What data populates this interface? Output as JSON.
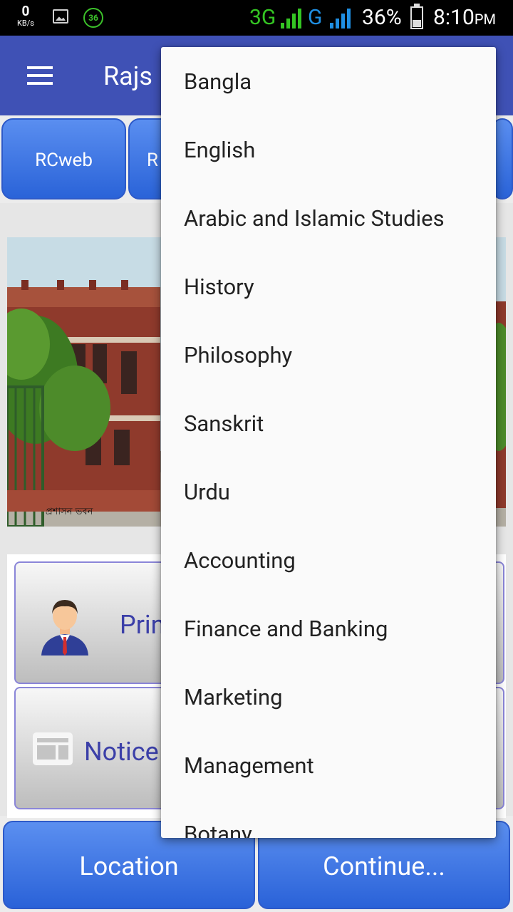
{
  "status_bar": {
    "speed_value": "0",
    "speed_unit": "KB/s",
    "badge": "36",
    "network_3g": "3G",
    "network_g": "G",
    "battery": "36%",
    "time": "8:10",
    "ampm": "PM"
  },
  "appbar": {
    "title": "Rajs"
  },
  "top_buttons": [
    "RCweb",
    "R"
  ],
  "photo": {
    "caption": "প্রশাসন ভবন"
  },
  "cards": {
    "principal": "Prin",
    "notice": "Notice"
  },
  "bottom_buttons": {
    "location": "Location",
    "continue": "Continue..."
  },
  "dropdown": {
    "items": [
      "Bangla",
      "English",
      "Arabic and Islamic Studies",
      "History",
      "Philosophy",
      "Sanskrit",
      "Urdu",
      "Accounting",
      "Finance and Banking",
      "Marketing",
      "Management",
      "Botany"
    ]
  },
  "colors": {
    "primary": "#3f51b5",
    "button_blue": "#2a63d8",
    "card_text": "#3b3fa8"
  }
}
